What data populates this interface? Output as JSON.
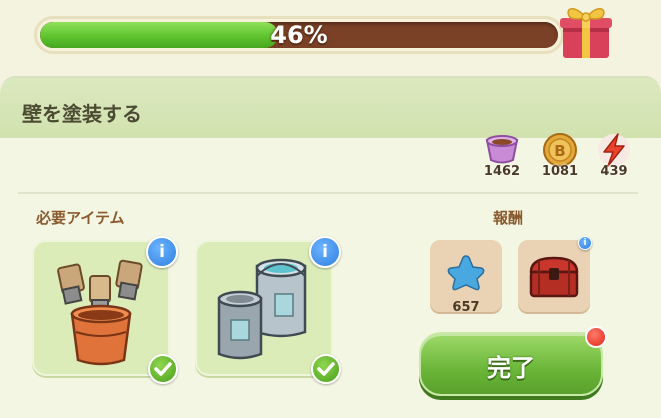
{
  "progress": {
    "percent_label": "46%",
    "fraction": 0.46
  },
  "task": {
    "title": "壁を塗装する"
  },
  "stats": [
    {
      "icon": "cup-icon",
      "value": "1462"
    },
    {
      "icon": "coin-icon",
      "value": "1081"
    },
    {
      "icon": "energy-icon",
      "value": "439"
    }
  ],
  "required": {
    "label": "必要アイテム",
    "items": [
      {
        "icon": "paint-brushes-bucket-icon",
        "status": "complete"
      },
      {
        "icon": "paint-cans-icon",
        "status": "complete"
      }
    ]
  },
  "rewards": {
    "label": "報酬",
    "items": [
      {
        "icon": "blue-star-icon",
        "count": "657"
      },
      {
        "icon": "red-chest-icon"
      }
    ]
  },
  "complete_button": {
    "label": "完了"
  },
  "colors": {
    "accent_green": "#6ab638",
    "progress_track": "#7a4126",
    "info_blue": "#2f7fe0"
  }
}
